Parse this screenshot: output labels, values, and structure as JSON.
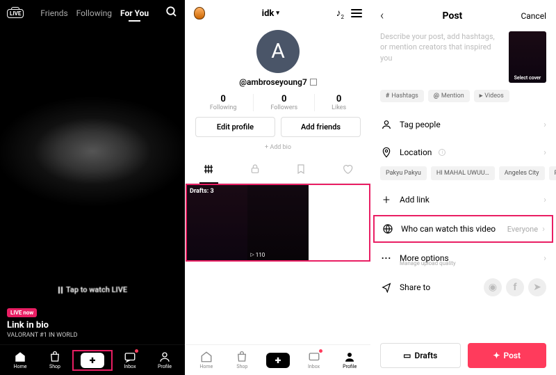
{
  "feed": {
    "tabs": {
      "friends": "Friends",
      "following": "Following",
      "foryou": "For You"
    },
    "tap_live": "Tap to watch LIVE",
    "live_now": "LIVE now",
    "title": "Link in bio",
    "subtitle": "VALORANT #1 IN WORLD"
  },
  "nav": {
    "home": "Home",
    "shop": "Shop",
    "inbox": "Inbox",
    "profile": "Profile"
  },
  "profile": {
    "title": "idk",
    "badge_count": "2",
    "avatar_letter": "A",
    "username": "@ambroseyoung7",
    "stats": [
      {
        "n": "0",
        "l": "Following"
      },
      {
        "n": "0",
        "l": "Followers"
      },
      {
        "n": "0",
        "l": "Likes"
      }
    ],
    "edit": "Edit profile",
    "add_friends": "Add friends",
    "add_bio": "+ Add bio",
    "drafts_label": "Drafts: 3",
    "play_count": "110"
  },
  "post": {
    "title": "Post",
    "cancel": "Cancel",
    "placeholder": "Describe your post, add hashtags, or mention creators that inspired you",
    "cover": "Select cover",
    "pills": {
      "hashtags": "Hashtags",
      "mention": "Mention",
      "videos": "Videos"
    },
    "tag_people": "Tag people",
    "location": "Location",
    "loc_chips": [
      "Pakyu Pakyu",
      "HI MAHAL UWUU…",
      "Angeles City",
      "Pa"
    ],
    "add_link": "Add link",
    "privacy": {
      "label": "Who can watch this video",
      "value": "Everyone"
    },
    "more_options": "More options",
    "more_sub": "Manage upload quality",
    "share_to": "Share to",
    "drafts_btn": "Drafts",
    "post_btn": "Post"
  }
}
